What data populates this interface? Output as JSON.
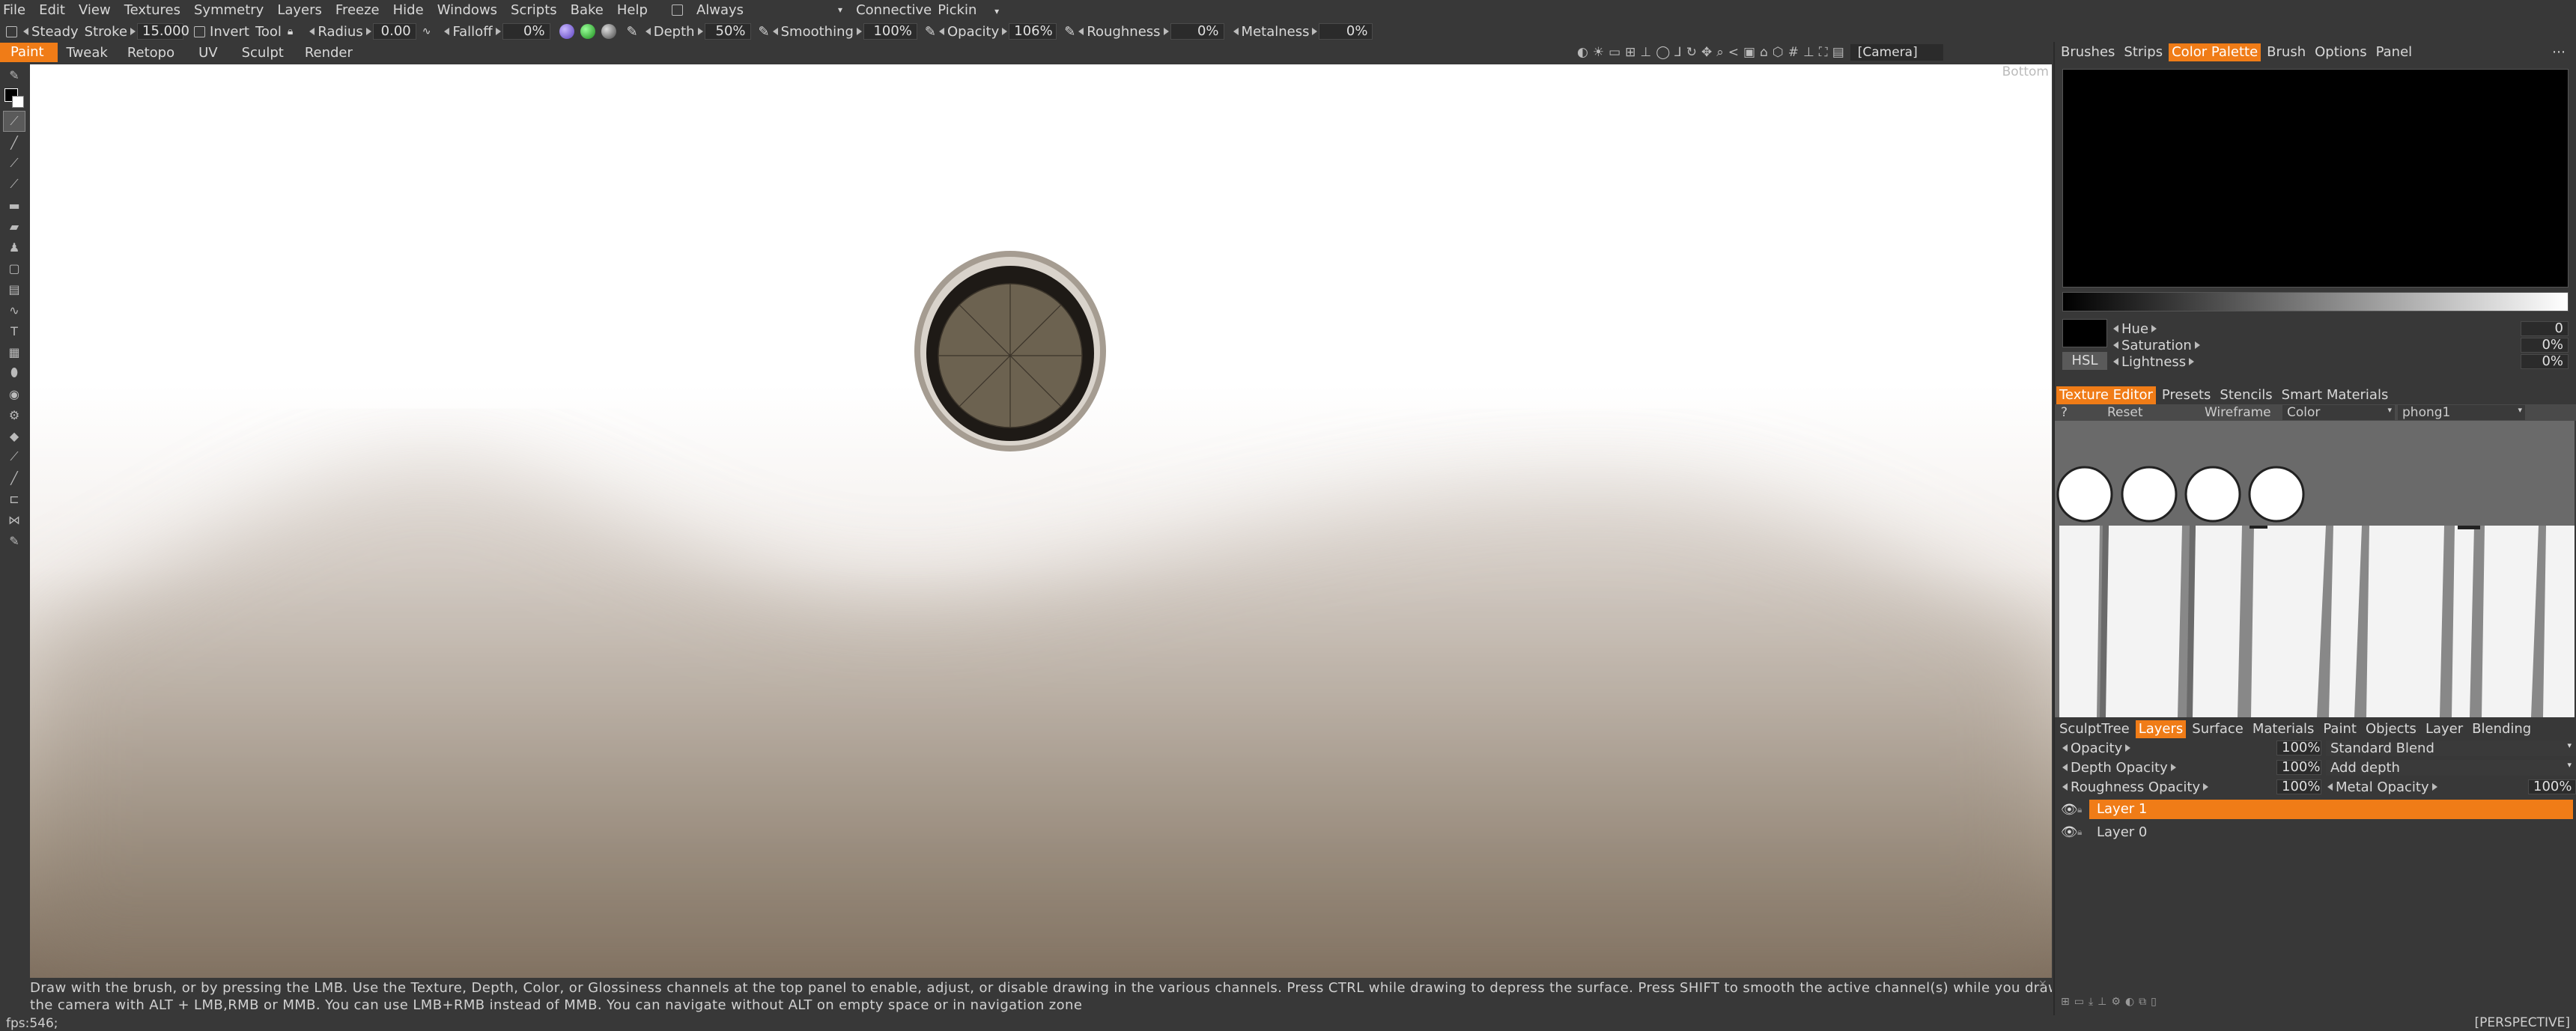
{
  "menu": [
    "File",
    "Edit",
    "View",
    "Textures",
    "Symmetry",
    "Layers",
    "Freeze",
    "Hide",
    "Windows",
    "Scripts",
    "Bake",
    "Help"
  ],
  "menu_extra": {
    "always": "Always",
    "connective": "Connective",
    "pickin": "Pickin"
  },
  "toolbar": {
    "steady_label": "Steady",
    "stroke_label": "Stroke",
    "stroke_value": "15.000",
    "invert_label": "Invert",
    "tool_label": "Tool",
    "radius_label": "Radius",
    "radius_value": "0.00",
    "falloff_label": "Falloff",
    "falloff_value": "0%",
    "depth_label": "Depth",
    "depth_value": "50%",
    "smoothing_label": "Smoothing",
    "smoothing_value": "100%",
    "opacity_label": "Opacity",
    "opacity_value": "106%",
    "roughness_label": "Roughness",
    "roughness_value": "0%",
    "metalness_label": "Metalness",
    "metalness_value": "0%"
  },
  "rooms": [
    "Paint",
    "Tweak",
    "Retopo",
    "UV",
    "Sculpt",
    "Render"
  ],
  "camera_label": "[Camera]",
  "view_corner": "Bottom",
  "hint_line1": "Draw with the brush, or by pressing the LMB. Use the Texture, Depth, Color, or Glossiness channels at the top panel to enable, adjust, or disable drawing in the various channels. Press CTRL while drawing to depress the surface. Press SHIFT to smooth the active channel(s) while you draw. Navigate",
  "hint_line2": "the camera with ALT + LMB,RMB or MMB. You can use LMB+RMB instead of MMB. You can navigate without ALT on empty space or in navigation zone",
  "fps": "fps:546;",
  "projection": "[PERSPECTIVE]",
  "color_panel": {
    "tabs": [
      "Brushes",
      "Strips",
      "Color Palette",
      "Brush",
      "Options",
      "Panel"
    ],
    "hsl_button": "HSL",
    "hue_label": "Hue",
    "hue_value": "0",
    "saturation_label": "Saturation",
    "saturation_value": "0%",
    "lightness_label": "Lightness",
    "lightness_value": "0%"
  },
  "texture_panel": {
    "tabs": [
      "Texture Editor",
      "Presets",
      "Stencils",
      "Smart Materials"
    ],
    "question": "?",
    "reset": "Reset",
    "wireframe": "Wireframe",
    "channel": "Color",
    "material": "phong1"
  },
  "layers_panel": {
    "tabs": [
      "SculptTree",
      "Layers",
      "Surface",
      "Materials",
      "Paint",
      "Objects",
      "Layer",
      "Blending"
    ],
    "opacity_label": "Opacity",
    "opacity_value": "100%",
    "blend": "Standard Blend",
    "depth_opacity_label": "Depth Opacity",
    "depth_opacity_value": "100%",
    "depth_mode": "Add depth",
    "roughness_opacity_label": "Roughness Opacity",
    "roughness_opacity_value": "100%",
    "metal_opacity_label": "Metal Opacity",
    "metal_opacity_value": "100%",
    "layers": [
      "Layer 1",
      "Layer 0"
    ]
  },
  "colors": {
    "accent": "#f07c17",
    "panel": "#383838"
  }
}
